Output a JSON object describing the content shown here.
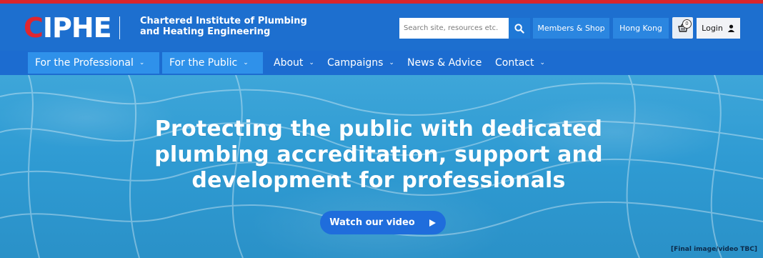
{
  "brand": {
    "logo_text": "CIPHE",
    "org_line1": "Chartered Institute of Plumbing",
    "org_line2": "and Heating Engineering"
  },
  "header": {
    "search_placeholder": "Search site, resources etc.",
    "members_label": "Members & Shop",
    "region_label": "Hong Kong",
    "basket_count": "0",
    "login_label": "Login"
  },
  "nav": {
    "items": [
      {
        "label": "For the Professional",
        "active": true
      },
      {
        "label": "For the Public",
        "active": true
      },
      {
        "label": "About",
        "active": false
      },
      {
        "label": "Campaigns",
        "active": false
      },
      {
        "label": "News & Advice",
        "active": false
      },
      {
        "label": "Contact",
        "active": false
      }
    ]
  },
  "hero": {
    "headline_line1": "Protecting the public with dedicated",
    "headline_line2": "plumbing accreditation, support and",
    "headline_line3": "development for professionals",
    "cta_label": "Watch our video",
    "note": "[Final image/video TBC]"
  },
  "colors": {
    "accent_red": "#d9262c",
    "header_blue": "#1d6fcf",
    "active_tab_blue": "#2f91ea"
  },
  "icons": {
    "search": "search-icon",
    "basket": "basket-icon",
    "user": "user-icon",
    "chevron": "chevron-down-icon",
    "play": "play-icon"
  }
}
